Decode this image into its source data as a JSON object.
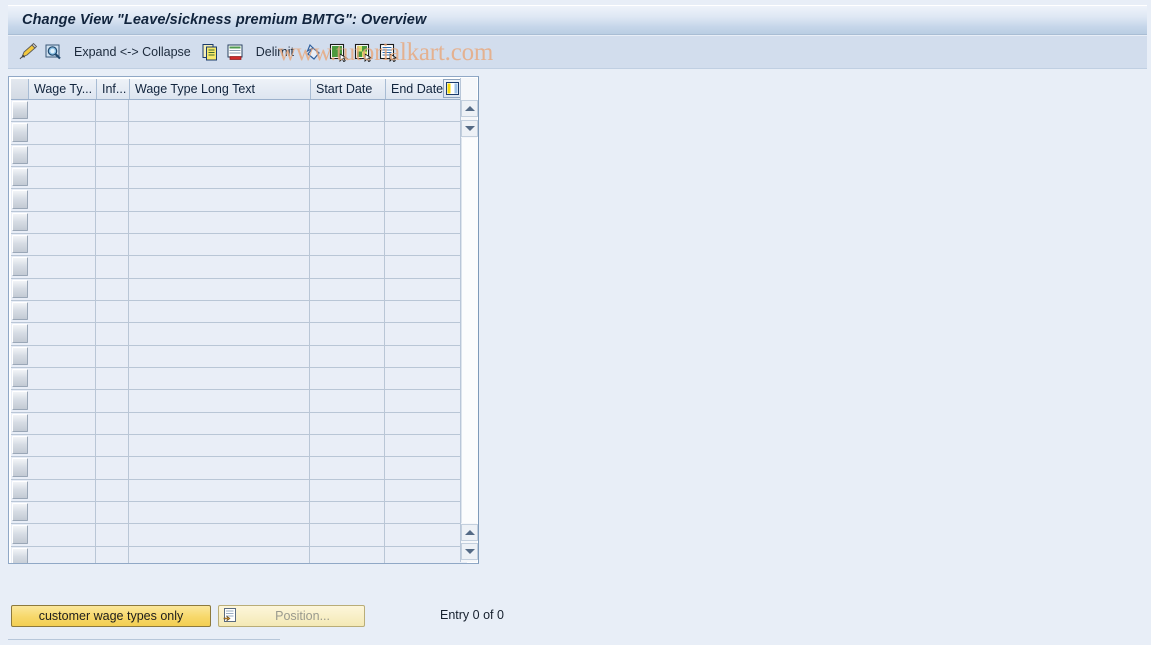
{
  "window": {
    "title": "Change View \"Leave/sickness premium BMTG\": Overview"
  },
  "watermark": {
    "text": "www.tutorialkart.com",
    "color": "#e8a87c"
  },
  "toolbar": {
    "items": [
      {
        "icon": "pencil-edit-icon",
        "label": ""
      },
      {
        "icon": "magnifier-display-icon",
        "label": ""
      },
      {
        "icon": "",
        "label": "Expand <-> Collapse"
      },
      {
        "icon": "copy-icon",
        "label": ""
      },
      {
        "icon": "delete-row-icon",
        "label": ""
      },
      {
        "icon": "",
        "label": "Delimit"
      },
      {
        "icon": "undo-arrow-icon",
        "label": ""
      },
      {
        "icon": "select-all-icon",
        "label": ""
      },
      {
        "icon": "deselect-all-icon",
        "label": ""
      },
      {
        "icon": "details-icon",
        "label": ""
      }
    ]
  },
  "table": {
    "columns": [
      {
        "key": "select",
        "label": ""
      },
      {
        "key": "wage_type",
        "label": "Wage Ty..."
      },
      {
        "key": "infotype",
        "label": "Inf..."
      },
      {
        "key": "long_text",
        "label": "Wage Type Long Text"
      },
      {
        "key": "start_date",
        "label": "Start Date"
      },
      {
        "key": "end_date",
        "label": "End Date"
      }
    ],
    "config_icon": "table-settings-icon",
    "rows": [],
    "empty_row_count": 21,
    "scrollbar": {
      "up_icon": "scroll-up-arrow-icon",
      "down_icon": "scroll-down-arrow-icon"
    }
  },
  "footer": {
    "customer_button": "customer wage types only",
    "position_button": "Position...",
    "position_icon": "position-icon",
    "entry_status": "Entry 0 of 0"
  },
  "colors": {
    "background": "#e8eef7",
    "toolbar": "#d2dded",
    "title_text": "#11243d",
    "accent_yellow": "#f7d86a",
    "grid_line": "#b9c6d6"
  }
}
